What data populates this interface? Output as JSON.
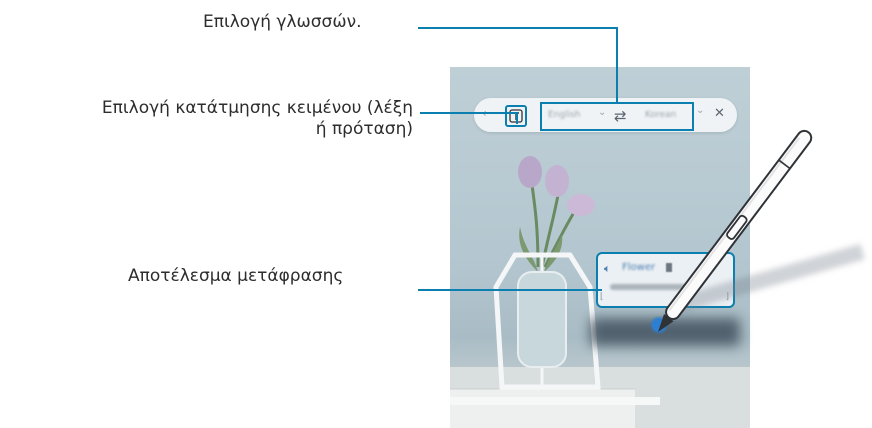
{
  "callouts": {
    "language_selection": "Επιλογή γλωσσών.",
    "text_unit_line1": "Επιλογή κατάτμησης κειμένου (λέξη",
    "text_unit_line2": "ή πρόταση)",
    "translation_result": "Αποτέλεσμα μετάφρασης"
  },
  "toolbar": {
    "source_language": "English",
    "target_language": "Korean",
    "text_mode_icon": "text-box-icon",
    "swap_icon": "swap-arrows-icon",
    "close_icon": "close-icon"
  },
  "result_popup": {
    "word": "Flower",
    "sound_icon": "speaker-icon"
  },
  "colors": {
    "callout_line": "#0a7fb0",
    "text": "#2d2d2d",
    "photo_background": "#b9cad2"
  }
}
